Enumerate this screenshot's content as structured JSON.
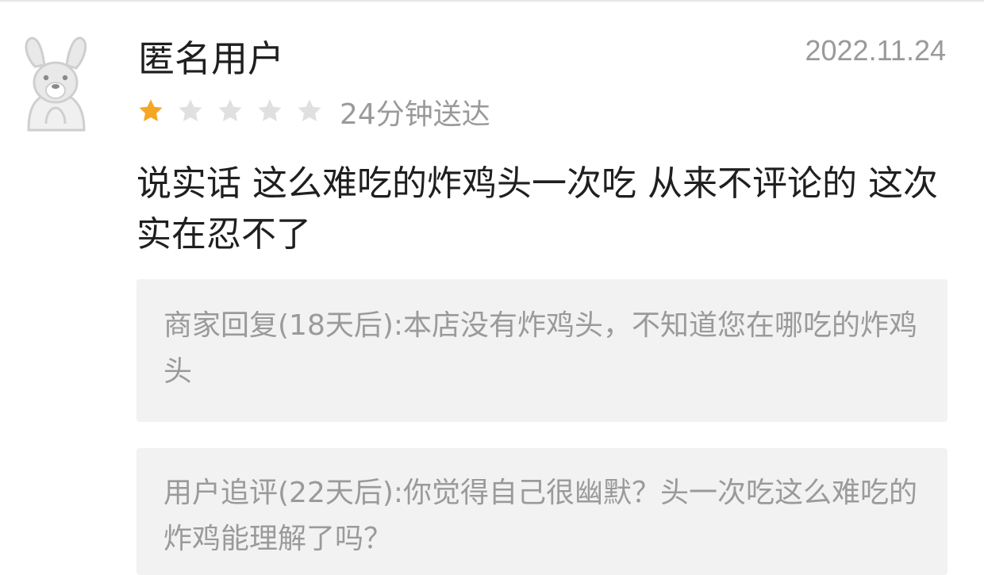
{
  "review": {
    "username": "匿名用户",
    "date": "2022.11.24",
    "rating": 1,
    "rating_max": 5,
    "delivery": "24分钟送达",
    "text": "说实话 这么难吃的炸鸡头一次吃 从来不评论的 这次实在忍不了"
  },
  "merchant_reply": {
    "text": "商家回复(18天后):本店没有炸鸡头，不知道您在哪吃的炸鸡头"
  },
  "follow_up": {
    "text": "用户追评(22天后):你觉得自己很幽默？头一次吃这么难吃的炸鸡能理解了吗？"
  },
  "colors": {
    "star_active": "#f5a623",
    "star_inactive": "#e0e0e0",
    "secondary_text": "#9a9a9a",
    "reply_background": "#f2f2f2"
  },
  "icons": {
    "avatar": "kangaroo-avatar-icon",
    "rating": "star-icon"
  }
}
